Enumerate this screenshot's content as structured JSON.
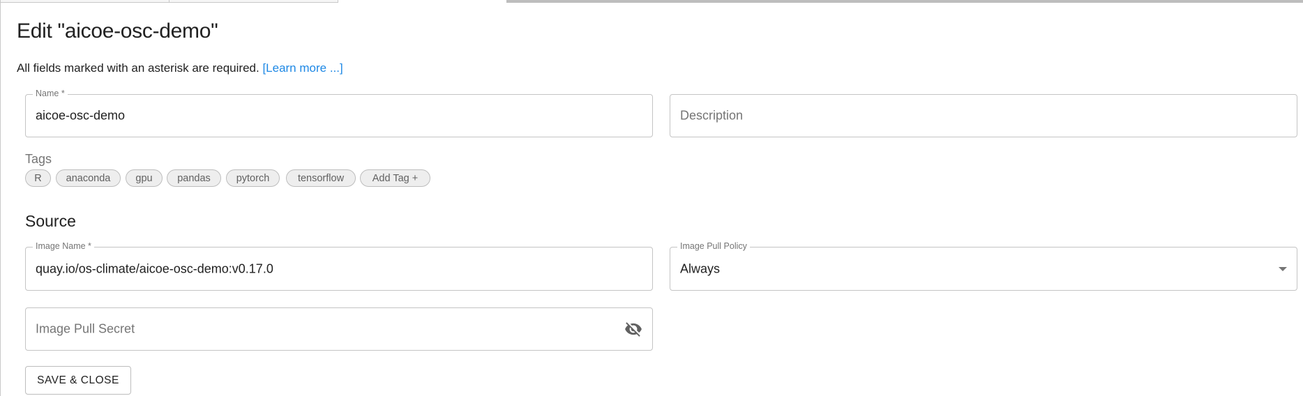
{
  "page": {
    "title": "Edit \"aicoe-osc-demo\"",
    "required_note": "All fields marked with an asterisk are required.",
    "learn_more": "[Learn more ...]"
  },
  "fields": {
    "name": {
      "label": "Name *",
      "value": "aicoe-osc-demo"
    },
    "description": {
      "placeholder": "Description"
    },
    "image_name": {
      "label": "Image Name *",
      "value": "quay.io/os-climate/aicoe-osc-demo:v0.17.0"
    },
    "image_pull_policy": {
      "label": "Image Pull Policy",
      "value": "Always"
    },
    "image_pull_secret": {
      "placeholder": "Image Pull Secret",
      "icon": "eye-off-icon"
    }
  },
  "tags": {
    "label": "Tags",
    "items": [
      "R",
      "anaconda",
      "gpu",
      "pandas",
      "pytorch",
      "tensorflow"
    ],
    "add_label": "Add Tag +"
  },
  "source": {
    "heading": "Source"
  },
  "actions": {
    "save_close": "SAVE & CLOSE"
  },
  "colors": {
    "link": "#1e88e5"
  }
}
